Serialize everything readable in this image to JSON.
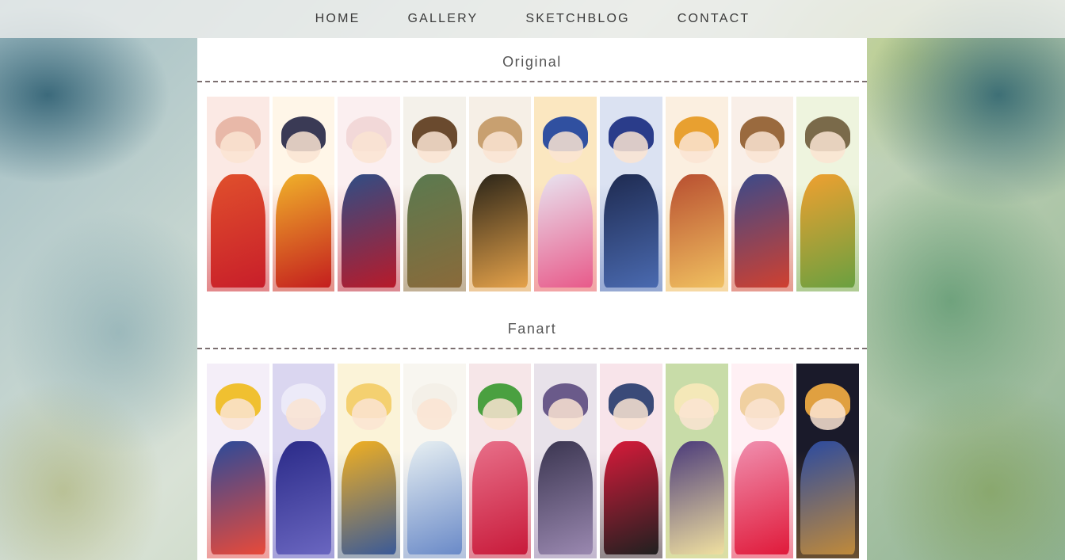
{
  "nav": {
    "items": [
      "HOME",
      "GALLERY",
      "SKETCHBLOG",
      "CONTACT"
    ]
  },
  "sections": {
    "original": {
      "title": "Original",
      "strips": [
        {
          "hair": "#e8b8a8",
          "body": "#e0502c",
          "bg": "#fbe9e4",
          "accent": "#c81e2a"
        },
        {
          "hair": "#3a3a55",
          "body": "#f0b22a",
          "bg": "#fff6e8",
          "accent": "#c41e1e"
        },
        {
          "hair": "#f2d8d8",
          "body": "#2e4e86",
          "bg": "#fbeff0",
          "accent": "#b81a2a"
        },
        {
          "hair": "#6a4a2e",
          "body": "#5a7a50",
          "bg": "#f4f1ea",
          "accent": "#8a6a3a"
        },
        {
          "hair": "#c8a070",
          "body": "#2a2418",
          "bg": "#f6efe6",
          "accent": "#e5a24a"
        },
        {
          "hair": "#3050a0",
          "body": "#e8e4f0",
          "bg": "#fbe7c0",
          "accent": "#e85a8a"
        },
        {
          "hair": "#2a3c8a",
          "body": "#1e2a50",
          "bg": "#dbe2f2",
          "accent": "#4a6ab0"
        },
        {
          "hair": "#e8a030",
          "body": "#b84e30",
          "bg": "#fbefe0",
          "accent": "#f0c060"
        },
        {
          "hair": "#9a6a3e",
          "body": "#3a4a8a",
          "bg": "#f9efe8",
          "accent": "#d04030"
        },
        {
          "hair": "#7a6a4a",
          "body": "#f0a030",
          "bg": "#eef4de",
          "accent": "#6aa040"
        }
      ]
    },
    "fanart": {
      "title": "Fanart",
      "strips": [
        {
          "hair": "#f0c030",
          "body": "#2a4a9a",
          "bg": "#f4eef8",
          "accent": "#e84a3a"
        },
        {
          "hair": "#eceaf8",
          "body": "#2a2a88",
          "bg": "#dad6f0",
          "accent": "#6a66c0"
        },
        {
          "hair": "#f4d070",
          "body": "#f2b020",
          "bg": "#fbf3d8",
          "accent": "#3a5a98"
        },
        {
          "hair": "#f4f0e8",
          "body": "#e8f0f2",
          "bg": "#f8f6f0",
          "accent": "#6a8ac8"
        },
        {
          "hair": "#4aa040",
          "body": "#e8708a",
          "bg": "#f6e6e8",
          "accent": "#c81a3a"
        },
        {
          "hair": "#6a5a8a",
          "body": "#3a3550",
          "bg": "#e8e2ea",
          "accent": "#9a88b0"
        },
        {
          "hair": "#3a4a78",
          "body": "#d81a3a",
          "bg": "#f8e4ea",
          "accent": "#202020"
        },
        {
          "hair": "#f4e8b8",
          "body": "#4a3a7a",
          "bg": "#c8dca8",
          "accent": "#f0e0a0"
        },
        {
          "hair": "#f0d0a0",
          "body": "#f090b0",
          "bg": "#fff0f4",
          "accent": "#e01a3a"
        },
        {
          "hair": "#e0a040",
          "body": "#2a4aa0",
          "bg": "#1a1a2a",
          "accent": "#c08a3a"
        }
      ]
    }
  }
}
